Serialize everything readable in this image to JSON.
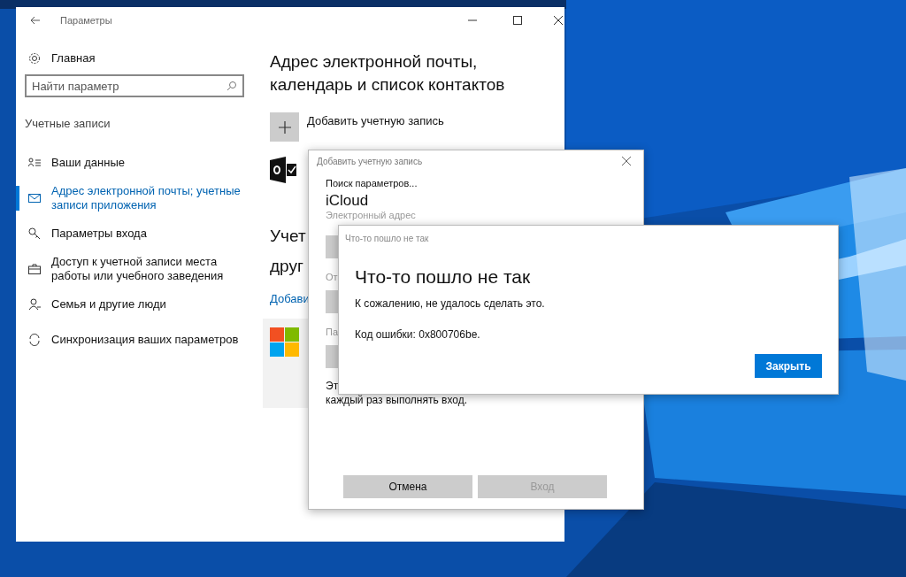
{
  "settings_window": {
    "title": "Параметры",
    "home": "Главная",
    "search": {
      "placeholder": "Найти параметр"
    },
    "section": "Учетные записи",
    "items": [
      {
        "label": "Ваши данные",
        "selected": false
      },
      {
        "label": "Адрес электронной почты; учетные записи приложения",
        "selected": true
      },
      {
        "label": "Параметры входа",
        "selected": false
      },
      {
        "label": "Доступ к учетной записи места работы или учебного заведения",
        "selected": false
      },
      {
        "label": "Семья и другие люди",
        "selected": false
      },
      {
        "label": "Синхронизация ваших параметров",
        "selected": false
      }
    ],
    "heading": "Адрес электронной почты, календарь и список контактов",
    "add_account": "Добавить учетную запись",
    "heading_2_lines": [
      "Учет",
      "друг"
    ],
    "link": "Добави"
  },
  "add_account_dialog": {
    "title": "Добавить учетную запись",
    "status": "Поиск параметров...",
    "provider": "iCloud",
    "fields": [
      {
        "label": "Электронный адрес"
      },
      {
        "label": "От"
      },
      {
        "label": "Па"
      }
    ],
    "note_lines": [
      "Эт",
      "каждый раз выполнять вход."
    ],
    "buttons": [
      {
        "label": "Отмена",
        "disabled": false
      },
      {
        "label": "Вход",
        "disabled": true
      }
    ]
  },
  "error_dialog": {
    "title": "Что-то пошло не так",
    "heading": "Что-то пошло не так",
    "message": "К сожалению, не удалось сделать это.",
    "code": "Код ошибки: 0x800706be.",
    "button": "Закрыть"
  }
}
